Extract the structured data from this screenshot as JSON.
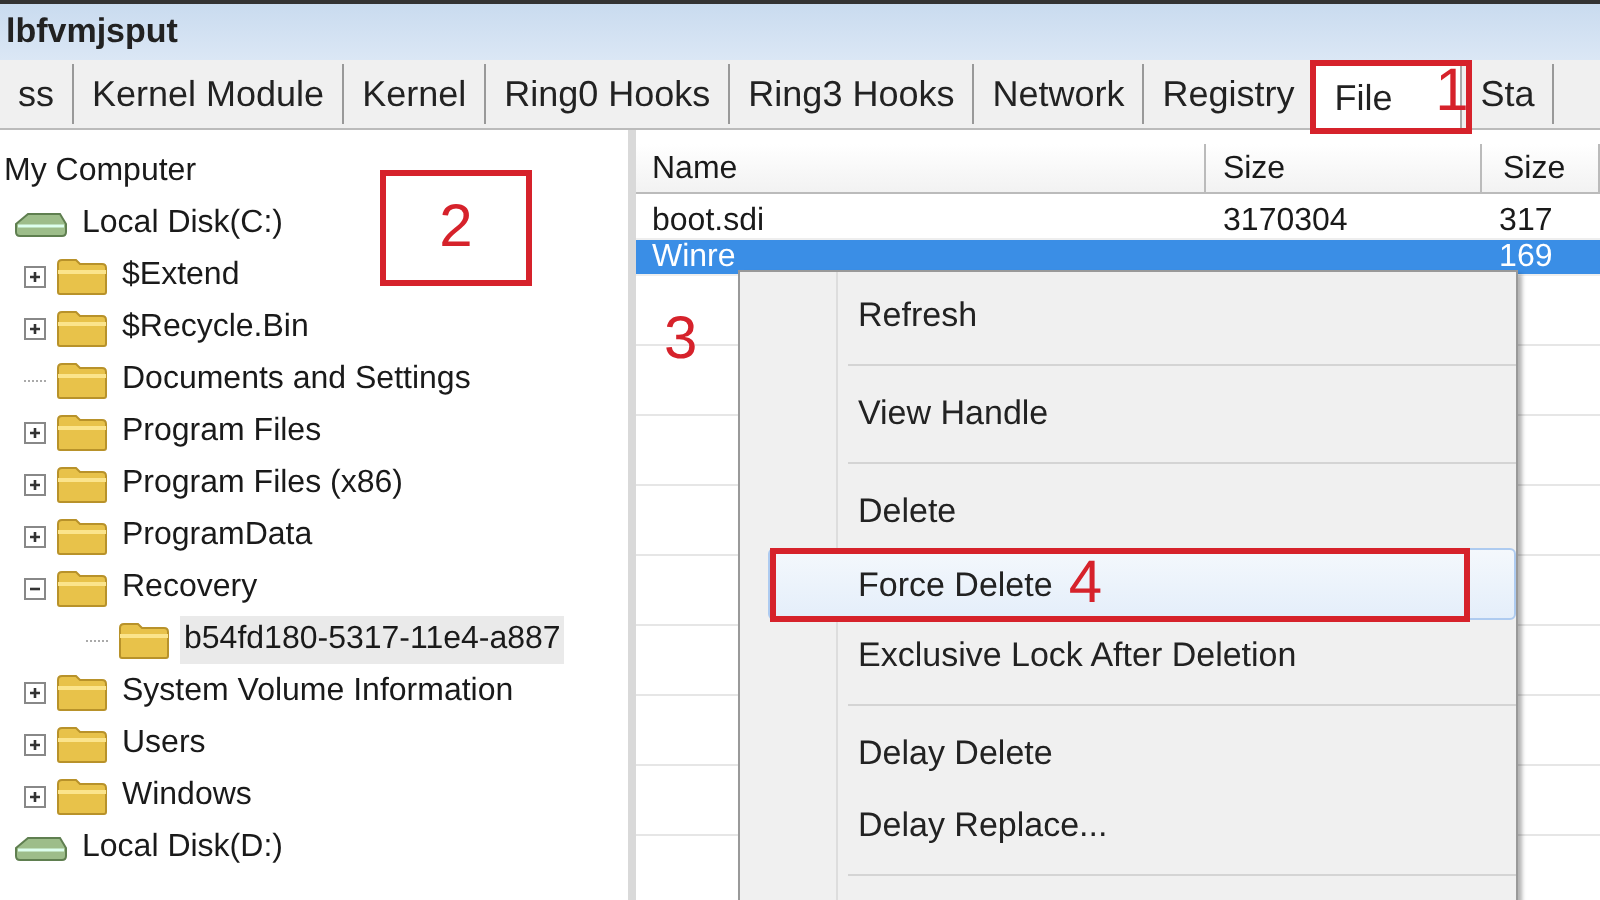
{
  "window": {
    "title": "lbfvmjsput"
  },
  "tabs": [
    {
      "label": "ss",
      "selected": false
    },
    {
      "label": "Kernel Module",
      "selected": false
    },
    {
      "label": "Kernel",
      "selected": false
    },
    {
      "label": "Ring0 Hooks",
      "selected": false
    },
    {
      "label": "Ring3 Hooks",
      "selected": false
    },
    {
      "label": "Network",
      "selected": false
    },
    {
      "label": "Registry",
      "selected": false
    },
    {
      "label": "File",
      "selected": true,
      "annotation": "1"
    },
    {
      "label": "Sta",
      "selected": false
    }
  ],
  "tree": {
    "annotation": "2",
    "items": [
      {
        "kind": "computer",
        "label": "My Computer",
        "children": [
          {
            "kind": "drive",
            "label": "Local Disk(C:)",
            "children": [
              {
                "kind": "folder",
                "label": "$Extend",
                "expanded": false
              },
              {
                "kind": "folder",
                "label": "$Recycle.Bin",
                "expanded": false
              },
              {
                "kind": "folder",
                "label": "Documents and Settings"
              },
              {
                "kind": "folder",
                "label": "Program Files",
                "expanded": false
              },
              {
                "kind": "folder",
                "label": "Program Files (x86)",
                "expanded": false
              },
              {
                "kind": "folder",
                "label": "ProgramData",
                "expanded": false
              },
              {
                "kind": "folder",
                "label": "Recovery",
                "expanded": true,
                "children": [
                  {
                    "kind": "folder",
                    "label": "b54fd180-5317-11e4-a887",
                    "selected": true
                  }
                ]
              },
              {
                "kind": "folder",
                "label": "System Volume Information",
                "expanded": false
              },
              {
                "kind": "folder",
                "label": "Users",
                "expanded": false
              },
              {
                "kind": "folder",
                "label": "Windows",
                "expanded": false
              }
            ]
          },
          {
            "kind": "drive",
            "label": "Local Disk(D:)"
          }
        ]
      }
    ]
  },
  "file_list": {
    "annotation": "3",
    "columns": [
      "Name",
      "Size",
      "Size"
    ],
    "rows": [
      {
        "name": "boot.sdi",
        "size": "3170304",
        "column_3": "317",
        "selected": false
      },
      {
        "name": "Winre",
        "column_3": "169",
        "selected": true
      }
    ]
  },
  "context_menu": {
    "items": [
      {
        "kind": "item",
        "label": "Refresh",
        "selected": false
      },
      {
        "kind": "separator"
      },
      {
        "kind": "item",
        "label": "View Handle",
        "selected": false
      },
      {
        "kind": "separator"
      },
      {
        "kind": "item",
        "label": "Delete",
        "selected": false
      },
      {
        "kind": "item",
        "label": "Force Delete",
        "selected": true,
        "annotation": "4"
      },
      {
        "kind": "item",
        "label": "Exclusive Lock After Deletion",
        "selected": false
      },
      {
        "kind": "separator"
      },
      {
        "kind": "item",
        "label": "Delay Delete",
        "selected": false
      },
      {
        "kind": "item",
        "label": "Delay Replace...",
        "selected": false
      },
      {
        "kind": "separator"
      }
    ]
  }
}
